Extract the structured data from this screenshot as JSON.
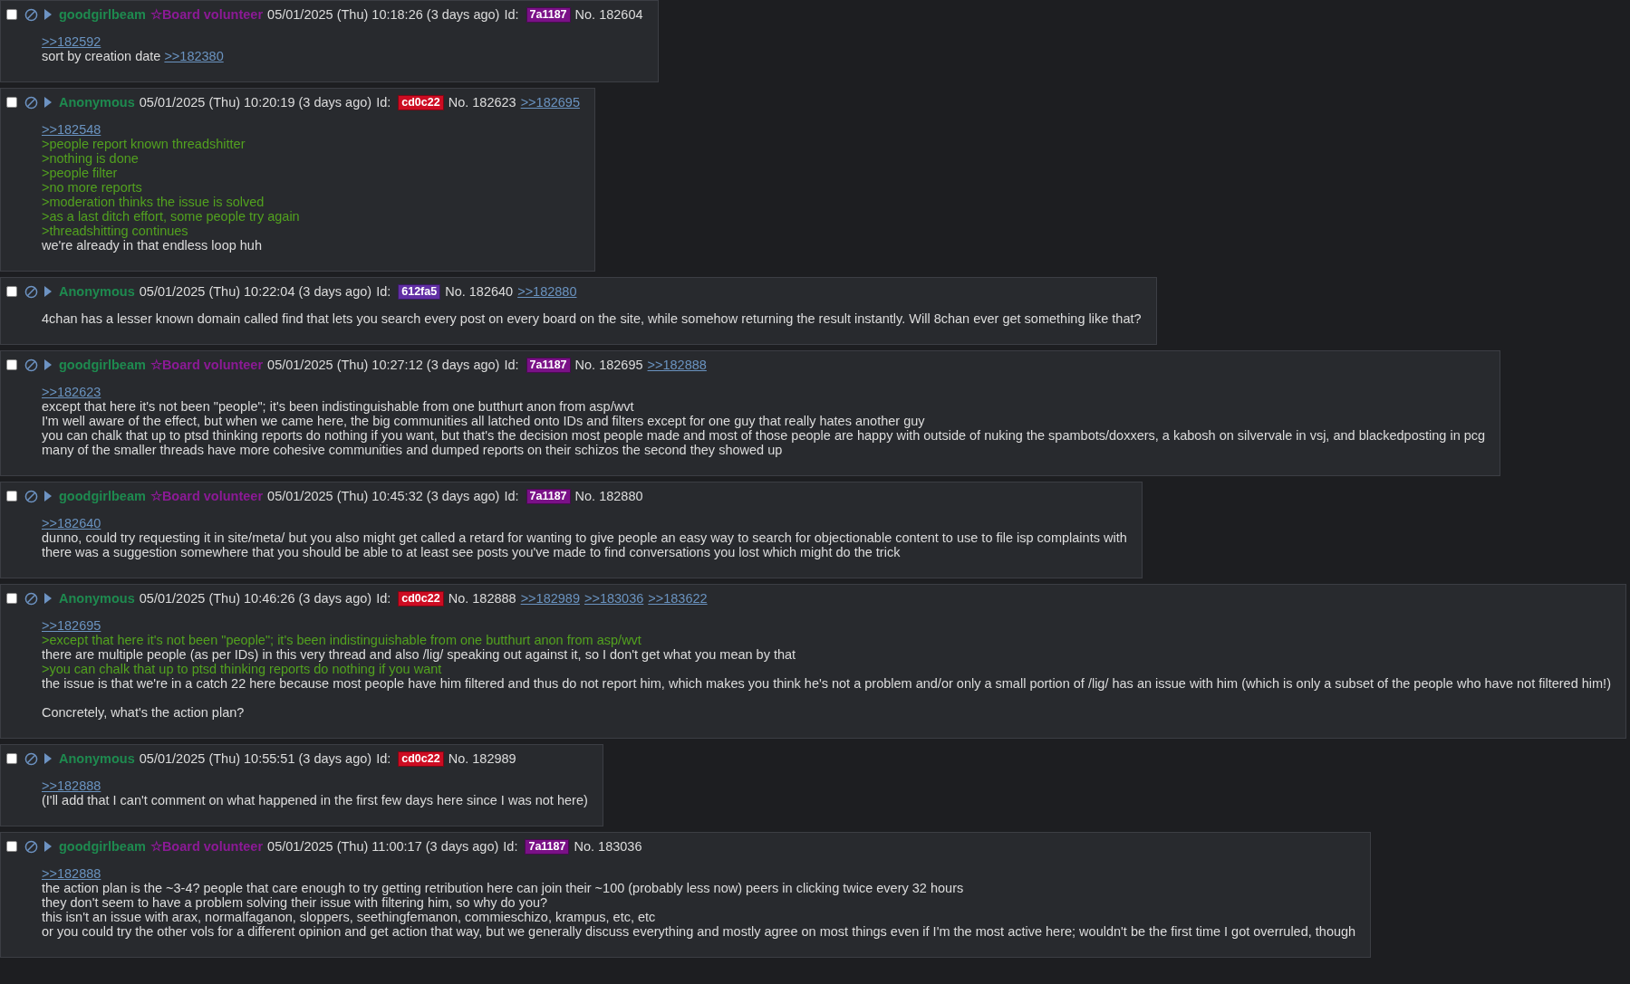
{
  "posts": [
    {
      "checked": false,
      "name": "goodgirlbeam",
      "capcode": "☆Board volunteer",
      "date": "05/01/2025 (Thu) 10:18:26 (3 days ago)",
      "id_label": "Id:",
      "id": "7a1187",
      "number": "No. 182604",
      "paragraphs": [
        [
          {
            "kind": "quote",
            "text": ">>182592"
          },
          {
            "kind": "text",
            "text": "sort by creation date",
            "link": ">>182380"
          }
        ]
      ]
    },
    {
      "checked": false,
      "name": "Anonymous",
      "date": "05/01/2025 (Thu) 10:20:19 (3 days ago)",
      "id_label": "Id:",
      "id": "cd0c22",
      "number": "No. 182623",
      "backlinks": [
        ">>182695"
      ],
      "paragraphs": [
        [
          {
            "kind": "quote",
            "text": ">>182548"
          },
          {
            "kind": "greentext",
            "text": ">people report known threadshitter"
          },
          {
            "kind": "greentext",
            "text": ">nothing is done"
          },
          {
            "kind": "greentext",
            "text": ">people filter"
          },
          {
            "kind": "greentext",
            "text": ">no more reports"
          },
          {
            "kind": "greentext",
            "text": ">moderation thinks the issue is solved"
          },
          {
            "kind": "greentext",
            "text": ">as a last ditch effort, some people try again"
          },
          {
            "kind": "greentext",
            "text": ">threadshitting continues"
          },
          {
            "kind": "text",
            "text": "we're already in that endless loop huh"
          }
        ]
      ]
    },
    {
      "checked": false,
      "name": "Anonymous",
      "date": "05/01/2025 (Thu) 10:22:04 (3 days ago)",
      "id_label": "Id:",
      "id": "612fa5",
      "number": "No. 182640",
      "backlinks": [
        ">>182880"
      ],
      "paragraphs": [
        [
          {
            "kind": "text",
            "text": "4chan has a lesser known domain called find that lets you search every post on every board on the site, while somehow returning the result instantly. Will 8chan ever get something like that?"
          }
        ]
      ]
    },
    {
      "checked": false,
      "name": "goodgirlbeam",
      "capcode": "☆Board volunteer",
      "date": "05/01/2025 (Thu) 10:27:12 (3 days ago)",
      "id_label": "Id:",
      "id": "7a1187",
      "number": "No. 182695",
      "backlinks": [
        ">>182888"
      ],
      "paragraphs": [
        [
          {
            "kind": "quote",
            "text": ">>182623"
          },
          {
            "kind": "text",
            "text": "except that here it's not been \"people\"; it's been indistinguishable from one butthurt anon from asp/wvt"
          },
          {
            "kind": "text",
            "text": "I'm well aware of the effect, but when we came here, the big communities all latched onto IDs and filters except for one guy that really hates another guy"
          },
          {
            "kind": "text",
            "text": "you can chalk that up to ptsd thinking reports do nothing if you want, but that's the decision most people made and most of those people are happy with outside of nuking the spambots/doxxers, a kabosh on silvervale in vsj, and blackedposting in pcg"
          },
          {
            "kind": "text",
            "text": "many of the smaller threads have more cohesive communities and dumped reports on their schizos the second they showed up"
          }
        ]
      ]
    },
    {
      "checked": false,
      "name": "goodgirlbeam",
      "capcode": "☆Board volunteer",
      "date": "05/01/2025 (Thu) 10:45:32 (3 days ago)",
      "id_label": "Id:",
      "id": "7a1187",
      "number": "No. 182880",
      "paragraphs": [
        [
          {
            "kind": "quote",
            "text": ">>182640"
          },
          {
            "kind": "text",
            "text": "dunno, could try requesting it in site/meta/ but you also might get called a retard for wanting to give people an easy way to search for objectionable content to use to file isp complaints with"
          },
          {
            "kind": "text",
            "text": "there was a suggestion somewhere that you should be able to at least see posts you've made to find conversations you lost which might do the trick"
          }
        ]
      ]
    },
    {
      "checked": false,
      "name": "Anonymous",
      "date": "05/01/2025 (Thu) 10:46:26 (3 days ago)",
      "id_label": "Id:",
      "id": "cd0c22",
      "number": "No. 182888",
      "backlinks": [
        ">>182989",
        ">>183036",
        ">>183622"
      ],
      "paragraphs": [
        [
          {
            "kind": "quote",
            "text": ">>182695"
          },
          {
            "kind": "greentext",
            "text": ">except that here it's not been \"people\"; it's been indistinguishable from one butthurt anon from asp/wvt"
          },
          {
            "kind": "text",
            "text": "there are multiple people (as per IDs) in this very thread and also /lig/ speaking out against it, so I don't get what you mean by that"
          },
          {
            "kind": "greentext",
            "text": ">you can chalk that up to ptsd thinking reports do nothing if you want"
          },
          {
            "kind": "text",
            "text": "the issue is that we're in a catch 22 here because most people have him filtered and thus do not report him, which makes you think he's not a problem and/or only a small portion of /lig/ has an issue with him (which is only a subset of the people who have not filtered him!)"
          }
        ],
        [
          {
            "kind": "text",
            "text": "Concretely, what's the action plan?"
          }
        ]
      ]
    },
    {
      "checked": false,
      "name": "Anonymous",
      "date": "05/01/2025 (Thu) 10:55:51 (3 days ago)",
      "id_label": "Id:",
      "id": "cd0c22",
      "number": "No. 182989",
      "paragraphs": [
        [
          {
            "kind": "quote",
            "text": ">>182888"
          },
          {
            "kind": "text",
            "text": "(I'll add that I can't comment on what happened in the first few days here since I was not here)"
          }
        ]
      ]
    },
    {
      "checked": false,
      "name": "goodgirlbeam",
      "capcode": "☆Board volunteer",
      "date": "05/01/2025 (Thu) 11:00:17 (3 days ago)",
      "id_label": "Id:",
      "id": "7a1187",
      "number": "No. 183036",
      "paragraphs": [
        [
          {
            "kind": "quote",
            "text": ">>182888"
          },
          {
            "kind": "text",
            "text": "the action plan is the ~3-4? people that care enough to try getting retribution here can join their ~100 (probably less now) peers in clicking twice every 32 hours"
          },
          {
            "kind": "text",
            "text": "they don't seem to have a problem solving their issue with filtering him, so why do you?"
          },
          {
            "kind": "text",
            "text": "this isn't an issue with arax, normalfaganon, sloppers, seethingfemanon, commieschizo, krampus, etc, etc"
          },
          {
            "kind": "text",
            "text": "or you could try the other vols for a different opinion and get action that way, but we generally discuss everything and mostly agree on most things even if I'm the most active here; wouldn't be the first time I got overruled, though"
          }
        ]
      ]
    }
  ]
}
